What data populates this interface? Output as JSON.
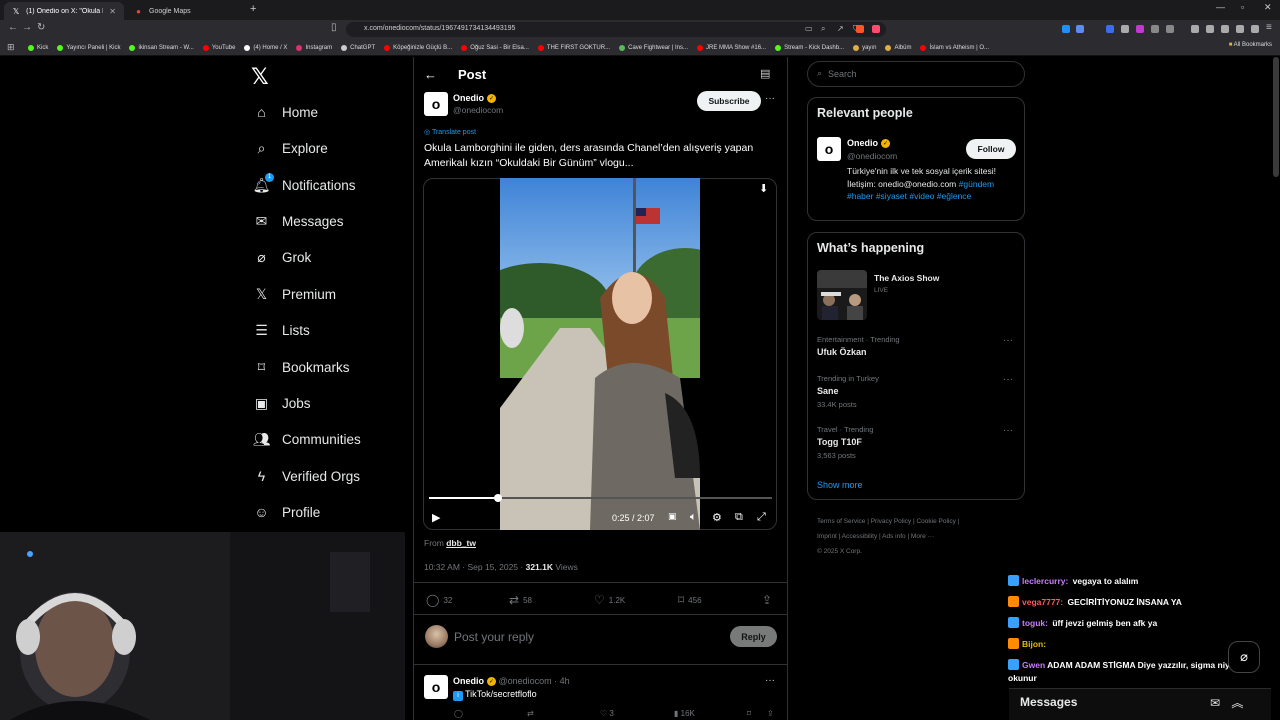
{
  "browser": {
    "tabs": [
      {
        "title": "(1) Onedio on X: \"Okula Lambor...",
        "icon": "x-logo-icon",
        "active": true
      },
      {
        "title": "Google Maps",
        "icon": "maps-pin-icon",
        "active": false
      }
    ],
    "url": "x.com/onediocom/status/1967491734134493195",
    "bookmarks": [
      {
        "label": "Kick",
        "color": "#53fc18"
      },
      {
        "label": "Yayıncı Paneli | Kick",
        "color": "#53fc18"
      },
      {
        "label": "ikinsan Stream - W...",
        "color": "#53fc18"
      },
      {
        "label": "YouTube",
        "color": "#ff0000"
      },
      {
        "label": "(4) Home / X",
        "color": "#ffffff"
      },
      {
        "label": "Instagram",
        "color": "#e1306c"
      },
      {
        "label": "ChatGPT",
        "color": "#cccccc"
      },
      {
        "label": "Köpeğinizle Güçlü B...",
        "color": "#ff0000"
      },
      {
        "label": "Oğuz Sasi - Bir Elsa...",
        "color": "#ff0000"
      },
      {
        "label": "THE FIRST GOKTUR...",
        "color": "#ff0000"
      },
      {
        "label": "Cave Fightwear | Ins...",
        "color": "#5cb85c"
      },
      {
        "label": "JRE MMA Show #16...",
        "color": "#ff0000"
      },
      {
        "label": "Stream - Kick Dashb...",
        "color": "#53fc18"
      },
      {
        "label": "yayın",
        "color": "#e0b040"
      },
      {
        "label": "Albüm",
        "color": "#e0b040"
      },
      {
        "label": "İslam vs Atheism | O...",
        "color": "#ff0000"
      }
    ],
    "all_bookmarks": "All Bookmarks"
  },
  "nav": {
    "items": [
      {
        "label": "Home",
        "icon": "home-icon"
      },
      {
        "label": "Explore",
        "icon": "search-icon"
      },
      {
        "label": "Notifications",
        "icon": "bell-icon",
        "badge": "1"
      },
      {
        "label": "Messages",
        "icon": "envelope-icon"
      },
      {
        "label": "Grok",
        "icon": "grok-icon"
      },
      {
        "label": "Premium",
        "icon": "x-logo-icon"
      },
      {
        "label": "Lists",
        "icon": "list-icon"
      },
      {
        "label": "Bookmarks",
        "icon": "bookmark-icon"
      },
      {
        "label": "Jobs",
        "icon": "briefcase-icon"
      },
      {
        "label": "Communities",
        "icon": "people-icon"
      },
      {
        "label": "Verified Orgs",
        "icon": "lightning-icon"
      },
      {
        "label": "Profile",
        "icon": "person-icon"
      }
    ]
  },
  "post": {
    "header_title": "Post",
    "author_name": "Onedio",
    "author_handle": "@onediocom",
    "subscribe_label": "Subscribe",
    "translate_label": "Translate post",
    "text": "Okula Lamborghini ile giden, ders arasında Chanel’den alışveriş yapan Amerikalı kızın “Okuldaki Bir Günüm” vlogu...",
    "video": {
      "time": "0:25 / 2:07",
      "progress": 0.2
    },
    "from_label": "From",
    "from_source": "dbb_tw",
    "timestamp": "10:32 AM · Sep 15, 2025 · ",
    "views_count": "321.1K",
    "views_label": " Views",
    "stats": {
      "replies": "32",
      "reposts": "58",
      "likes": "1.2K",
      "bookmarks": "456"
    },
    "reply_placeholder": "Post your reply",
    "reply_button": "Reply"
  },
  "reply2": {
    "name": "Onedio",
    "handle": "@onediocom · 4h",
    "text": "TikTok/secretfloflo",
    "stats": {
      "likes": "3",
      "views": "16K"
    }
  },
  "sidebar": {
    "search_placeholder": "Search",
    "relevant_title": "Relevant people",
    "relevant": {
      "name": "Onedio",
      "handle": "@onediocom",
      "follow_label": "Follow",
      "bio": "Türkiye'nin ilk ve tek sosyal içerik sitesi! İletişim: onedio@onedio.com",
      "tags": "#gündem #haber #siyaset #video #eğlence"
    },
    "happening_title": "What’s happening",
    "live": {
      "title": "The Axios Show",
      "status": "LIVE"
    },
    "trends": [
      {
        "category": "Entertainment · Trending",
        "name": "Ufuk Özkan",
        "count": ""
      },
      {
        "category": "Trending in Turkey",
        "name": "Sane",
        "count": "33.4K posts"
      },
      {
        "category": "Travel · Trending",
        "name": "Togg T10F",
        "count": "3,563 posts"
      }
    ],
    "show_more": "Show more",
    "footer_line1": "Terms of Service  |  Privacy Policy  |  Cookie Policy  |",
    "footer_line2": "Imprint  |  Accessibility  |  Ads info  |  More ···",
    "footer_line3": "© 2025 X Corp."
  },
  "chat": [
    {
      "user": "leclercurry:",
      "text": " vegaya to alalım",
      "color": "#c77dff"
    },
    {
      "user": "vega7777:",
      "text": " GECİRİTİYONUZ İNSANA YA",
      "color": "#ff5a5a"
    },
    {
      "user": "toguk:",
      "text": " üff jevzi gelmiş ben afk ya",
      "color": "#c77dff"
    },
    {
      "user": "Bijon:",
      "text": "",
      "color": "#e0c000"
    },
    {
      "user": "Gwen",
      "text": "ADAM ADAM STİGMA Diye yazzılır, sigma niye",
      "color": "#c77dff"
    },
    {
      "user": "",
      "text": "okunur",
      "color": "#ffffff"
    }
  ],
  "messages_drawer": {
    "title": "Messages"
  }
}
